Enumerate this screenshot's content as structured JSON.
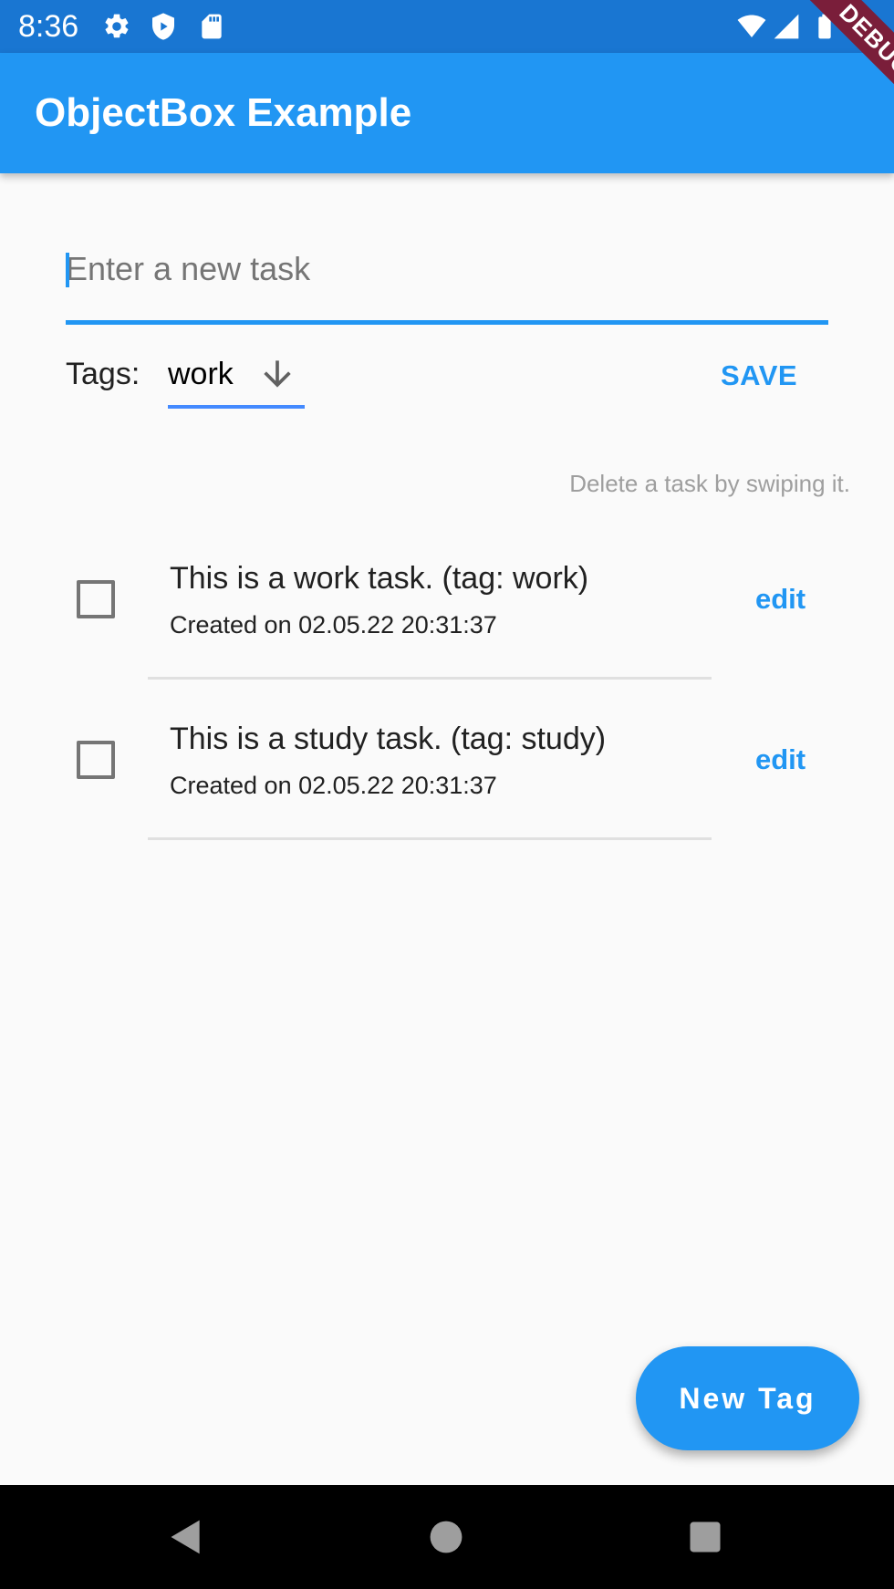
{
  "status_bar": {
    "time": "8:36",
    "icons": [
      "gear-icon",
      "shield-icon",
      "sd-card-icon",
      "wifi-icon",
      "signal-icon",
      "battery-icon"
    ]
  },
  "app_bar": {
    "title": "ObjectBox Example"
  },
  "debug_banner": {
    "label": "DEBUG"
  },
  "task_form": {
    "input_value": "",
    "input_placeholder": "Enter a new task",
    "tags_label": "Tags:",
    "selected_tag": "work",
    "save_label": "SAVE"
  },
  "hint": "Delete a task by swiping it.",
  "tasks": [
    {
      "title": "This is a work task. (tag: work)",
      "created": "Created on 02.05.22 20:31:37",
      "edit_label": "edit",
      "checked": false
    },
    {
      "title": "This is a study task. (tag: study)",
      "created": "Created on 02.05.22 20:31:37",
      "edit_label": "edit",
      "checked": false
    }
  ],
  "fab": {
    "label": "New Tag"
  },
  "colors": {
    "primary": "#2196f3",
    "status_bar": "#1976d2",
    "debug_ribbon": "#7a1e3a",
    "background": "#fafafa"
  }
}
